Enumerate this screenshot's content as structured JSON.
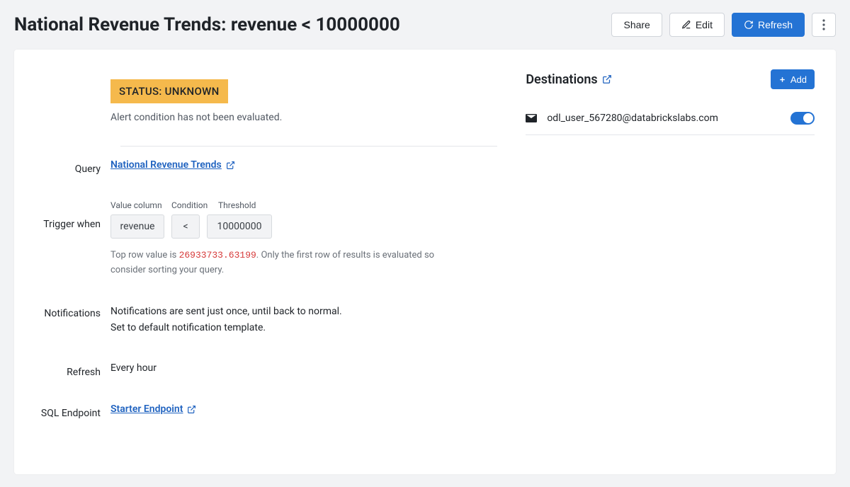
{
  "header": {
    "title": "National Revenue Trends: revenue < 10000000",
    "share_label": "Share",
    "edit_label": "Edit",
    "refresh_label": "Refresh"
  },
  "status": {
    "badge_text": "STATUS: UNKNOWN",
    "note": "Alert condition has not been evaluated."
  },
  "labels": {
    "query": "Query",
    "trigger": "Trigger when",
    "notifications": "Notifications",
    "refresh": "Refresh",
    "endpoint": "SQL Endpoint"
  },
  "query": {
    "link_text": "National Revenue Trends"
  },
  "trigger": {
    "col_label_value": "Value column",
    "col_label_condition": "Condition",
    "col_label_threshold": "Threshold",
    "value_column": "revenue",
    "condition": "<",
    "threshold": "10000000",
    "helper_prefix": "Top row value is ",
    "helper_value": "26933733.63199",
    "helper_suffix": ". Only the first row of results is evaluated so consider sorting your query."
  },
  "notifications": {
    "line1": "Notifications are sent just once, until back to normal.",
    "line2": "Set to default notification template."
  },
  "refresh": {
    "value": "Every hour"
  },
  "endpoint": {
    "link_text": "Starter Endpoint"
  },
  "destinations": {
    "title": "Destinations",
    "add_label": "Add",
    "items": [
      {
        "email": "odl_user_567280@databrickslabs.com",
        "enabled": true
      }
    ]
  }
}
